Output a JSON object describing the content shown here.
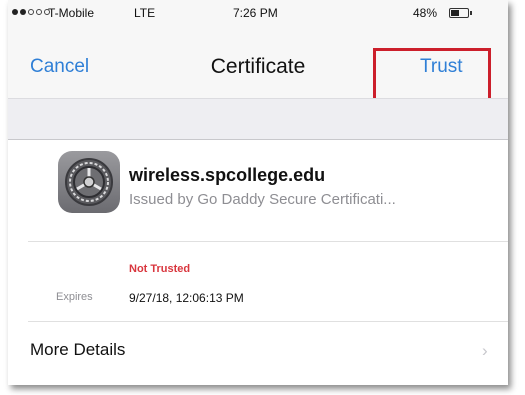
{
  "status_bar": {
    "carrier": "T-Mobile",
    "network": "LTE",
    "time": "7:26 PM",
    "battery": "48%",
    "battery_level": 0.48
  },
  "nav": {
    "cancel_label": "Cancel",
    "title": "Certificate",
    "trust_label": "Trust"
  },
  "certificate": {
    "name": "wireless.spcollege.edu",
    "issuer": "Issued by Go Daddy Secure Certificati...",
    "status": "Not Trusted",
    "expires_label": "Expires",
    "expires_value": "9/27/18, 12:06:13 PM"
  },
  "more_details_label": "More Details",
  "icons": [
    "settings-gear-icon",
    "chevron-right-icon",
    "battery-icon",
    "signal-icon"
  ],
  "colors": {
    "accent": "#2f7fd6",
    "warning": "#d9363e",
    "highlight": "#cc1f2b"
  }
}
